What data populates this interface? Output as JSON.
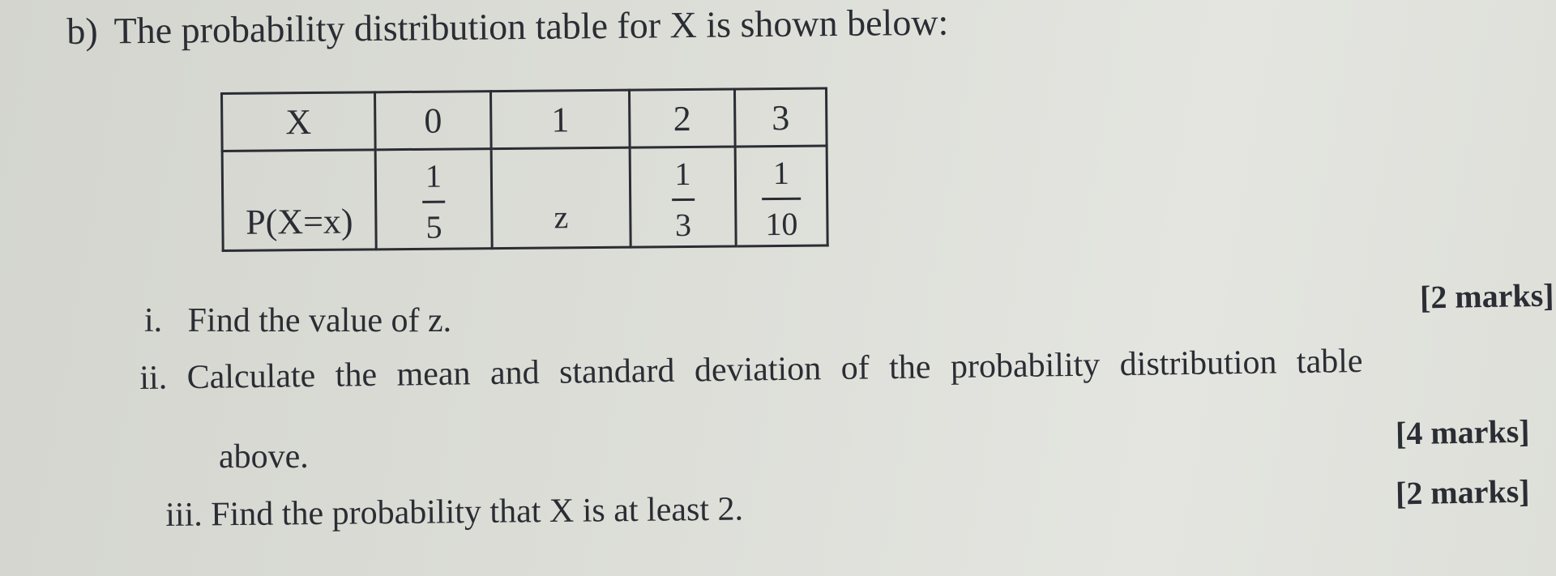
{
  "heading": {
    "label": "b)",
    "text": "The probability distribution table for X is shown below:"
  },
  "table": {
    "row_header_x": "X",
    "row_header_p": "P(X=x)",
    "x_values": [
      "0",
      "1",
      "2",
      "3"
    ],
    "probabilities": [
      {
        "type": "fraction",
        "numerator": "1",
        "denominator": "5"
      },
      {
        "type": "text",
        "value": "z"
      },
      {
        "type": "fraction",
        "numerator": "1",
        "denominator": "3"
      },
      {
        "type": "fraction",
        "numerator": "1",
        "denominator": "10"
      }
    ]
  },
  "questions": [
    {
      "number": "i.",
      "text": "Find the value of z.",
      "marks": "[2 marks]"
    },
    {
      "number": "ii.",
      "text": "Calculate the mean and standard deviation of the probability distribution table",
      "continuation": "above.",
      "marks": "[4 marks]"
    },
    {
      "number": "iii.",
      "text": "Find the probability that X is at least 2.",
      "marks": "[2 marks]"
    }
  ]
}
